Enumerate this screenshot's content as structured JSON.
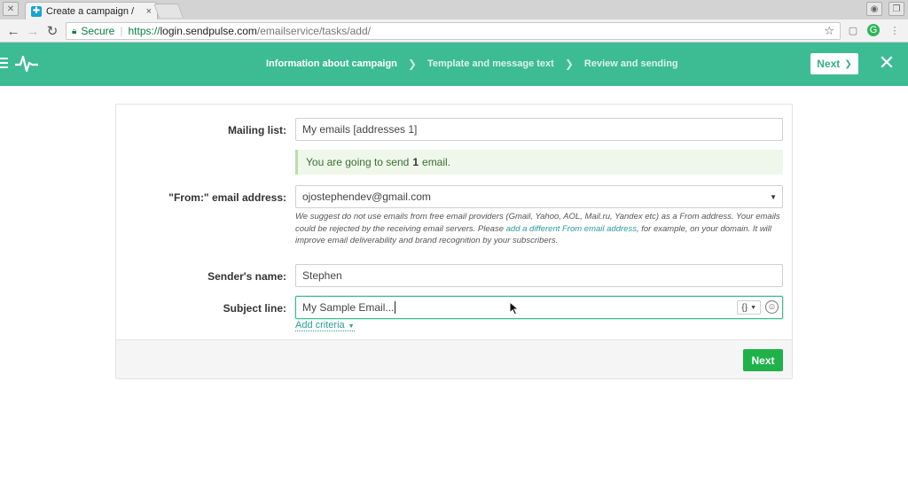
{
  "browser": {
    "tab_title": "Create a campaign / My",
    "tab_close": "×",
    "secure_label": "Secure",
    "url_scheme": "https://",
    "url_host": "login.sendpulse.com",
    "url_path": "/emailservice/tasks/add/"
  },
  "header": {
    "steps": [
      {
        "label": "Information about campaign",
        "active": true
      },
      {
        "label": "Template and message text",
        "active": false
      },
      {
        "label": "Review and sending",
        "active": false
      }
    ],
    "next_label": "Next",
    "close_icon": "close-icon"
  },
  "form": {
    "mailing_list": {
      "label": "Mailing list:",
      "value": "My emails [addresses 1]"
    },
    "alert": {
      "prefix": "You are going to send",
      "count": "1",
      "suffix": "email."
    },
    "from": {
      "label": "\"From:\" email address:",
      "value": "ojostephendev@gmail.com",
      "hint_before": "We suggest do not use emails from free email providers (Gmail, Yahoo, AOL, Mail.ru, Yandex etc) as a From address. Your emails could be rejected by the receiving email servers. Please ",
      "hint_link": "add a different From email address",
      "hint_after": ", for example, on your domain. It will improve email deliverability and brand recognition by your subscribers."
    },
    "sender": {
      "label": "Sender's name:",
      "value": "Stephen"
    },
    "subject": {
      "label": "Subject line:",
      "value": "My Sample Email...",
      "var_label": "{}"
    },
    "add_criteria": "Add criteria",
    "next_label": "Next"
  },
  "colors": {
    "brand": "#3dbb92",
    "primary_button": "#1fb24b",
    "link": "#2a9c9a"
  }
}
